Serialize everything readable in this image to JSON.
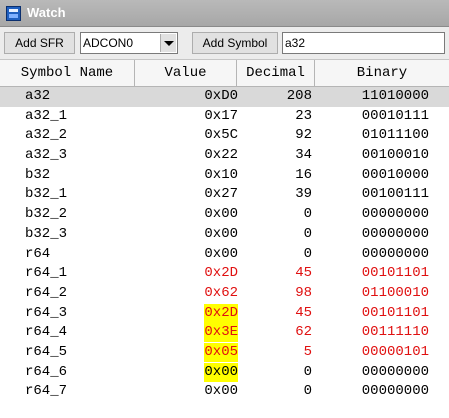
{
  "window": {
    "title": "Watch"
  },
  "toolbar": {
    "add_sfr_label": "Add SFR",
    "sfr_selected": "ADCON0",
    "add_symbol_label": "Add Symbol",
    "symbol_input_value": "a32"
  },
  "columns": {
    "symbol": "Symbol Name",
    "value": "Value",
    "decimal": "Decimal",
    "binary": "Binary"
  },
  "colors": {
    "changed_text": "#e01010",
    "highlight": "#ffff00",
    "selected_row": "#d9d9d9"
  },
  "rows": [
    {
      "name": "a32",
      "value": "0xD0",
      "decimal": "208",
      "binary": "11010000",
      "changed": false,
      "highlighted": false,
      "selected": true
    },
    {
      "name": "a32_1",
      "value": "0x17",
      "decimal": "23",
      "binary": "00010111",
      "changed": false,
      "highlighted": false
    },
    {
      "name": "a32_2",
      "value": "0x5C",
      "decimal": "92",
      "binary": "01011100",
      "changed": false,
      "highlighted": false
    },
    {
      "name": "a32_3",
      "value": "0x22",
      "decimal": "34",
      "binary": "00100010",
      "changed": false,
      "highlighted": false
    },
    {
      "name": "b32",
      "value": "0x10",
      "decimal": "16",
      "binary": "00010000",
      "changed": false,
      "highlighted": false
    },
    {
      "name": "b32_1",
      "value": "0x27",
      "decimal": "39",
      "binary": "00100111",
      "changed": false,
      "highlighted": false
    },
    {
      "name": "b32_2",
      "value": "0x00",
      "decimal": "0",
      "binary": "00000000",
      "changed": false,
      "highlighted": false
    },
    {
      "name": "b32_3",
      "value": "0x00",
      "decimal": "0",
      "binary": "00000000",
      "changed": false,
      "highlighted": false
    },
    {
      "name": "r64",
      "value": "0x00",
      "decimal": "0",
      "binary": "00000000",
      "changed": false,
      "highlighted": false
    },
    {
      "name": "r64_1",
      "value": "0x2D",
      "decimal": "45",
      "binary": "00101101",
      "changed": true,
      "highlighted": false
    },
    {
      "name": "r64_2",
      "value": "0x62",
      "decimal": "98",
      "binary": "01100010",
      "changed": true,
      "highlighted": false
    },
    {
      "name": "r64_3",
      "value": "0x2D",
      "decimal": "45",
      "binary": "00101101",
      "changed": true,
      "highlighted": true
    },
    {
      "name": "r64_4",
      "value": "0x3E",
      "decimal": "62",
      "binary": "00111110",
      "changed": true,
      "highlighted": true
    },
    {
      "name": "r64_5",
      "value": "0x05",
      "decimal": "5",
      "binary": "00000101",
      "changed": true,
      "highlighted": true
    },
    {
      "name": "r64_6",
      "value": "0x00",
      "decimal": "0",
      "binary": "00000000",
      "changed": false,
      "highlighted": true
    },
    {
      "name": "r64_7",
      "value": "0x00",
      "decimal": "0",
      "binary": "00000000",
      "changed": false,
      "highlighted": false
    }
  ]
}
